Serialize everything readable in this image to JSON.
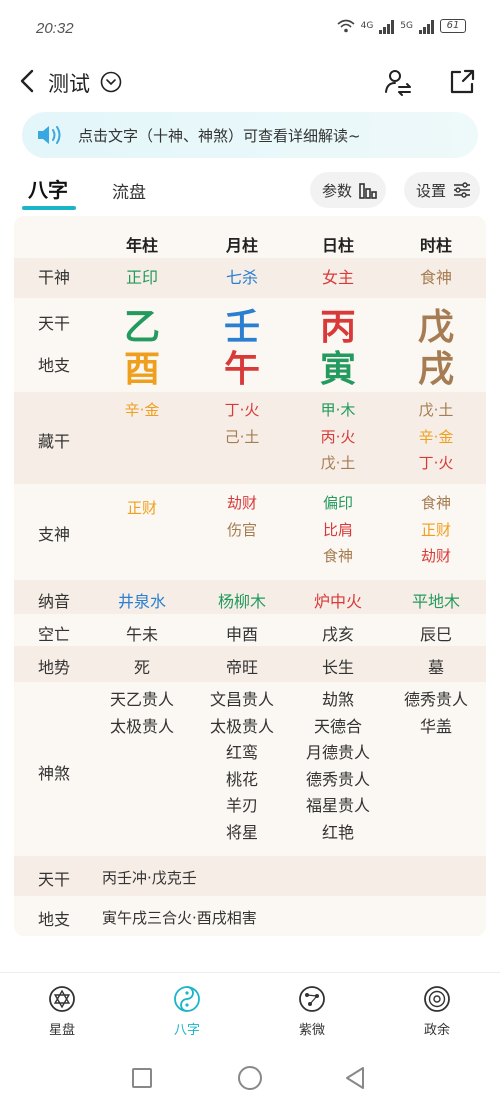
{
  "status": {
    "time": "20:32",
    "net1": "4G",
    "net2": "5G",
    "battery": "61"
  },
  "header": {
    "title": "测试"
  },
  "tip": {
    "text": "点击文字（十神、神煞）可查看详细解读~"
  },
  "tabs": {
    "bazi": "八字",
    "liupan": "流盘",
    "params": "参数",
    "settings": "设置"
  },
  "colors": {
    "accent": "#1bb5c8",
    "wood": "#239a5e",
    "fire": "#d83a3a",
    "earth": "#a67c52",
    "metal": "#ef9f1e",
    "water": "#2a7fd0"
  },
  "table": {
    "columns": [
      "年柱",
      "月柱",
      "日柱",
      "时柱"
    ],
    "labels": {
      "shishen": "干神",
      "tiangan": "天干",
      "dizhi": "地支",
      "canggan": "藏干",
      "zhishen": "支神",
      "nayin": "纳音",
      "kongwang": "空亡",
      "dishi": "地势",
      "shensha": "神煞"
    },
    "shishen": [
      "正印",
      "七杀",
      "女主",
      "食神"
    ],
    "tiangan": [
      "乙",
      "壬",
      "丙",
      "戊"
    ],
    "dizhi": [
      "酉",
      "午",
      "寅",
      "戌"
    ],
    "canggan": [
      [
        "辛·金"
      ],
      [
        "丁·火",
        "己·土"
      ],
      [
        "甲·木",
        "丙·火",
        "戊·土"
      ],
      [
        "戊·土",
        "辛·金",
        "丁·火"
      ]
    ],
    "zhishen": [
      [
        "正财"
      ],
      [
        "劫财",
        "伤官"
      ],
      [
        "偏印",
        "比肩",
        "食神"
      ],
      [
        "食神",
        "正财",
        "劫财"
      ]
    ],
    "nayin": [
      "井泉水",
      "杨柳木",
      "炉中火",
      "平地木"
    ],
    "kongwang": [
      "午未",
      "申酉",
      "戌亥",
      "辰巳"
    ],
    "dishi": [
      "死",
      "帝旺",
      "长生",
      "墓"
    ],
    "shensha": [
      [
        "天乙贵人",
        "太极贵人"
      ],
      [
        "文昌贵人",
        "太极贵人",
        "红鸾",
        "桃花",
        "羊刃",
        "将星"
      ],
      [
        "劫煞",
        "天德合",
        "月德贵人",
        "德秀贵人",
        "福星贵人",
        "红艳"
      ],
      [
        "德秀贵人",
        "华盖"
      ]
    ]
  },
  "interactions": {
    "tiangan_label": "天干",
    "tiangan_text": "丙壬冲·戊克壬",
    "dizhi_label": "地支",
    "dizhi_text": "寅午戌三合火·酉戌相害"
  },
  "nav": [
    {
      "label": "星盘",
      "icon": "star-chart-icon"
    },
    {
      "label": "八字",
      "icon": "yin-yang-icon"
    },
    {
      "label": "紫微",
      "icon": "ziwei-icon"
    },
    {
      "label": "政余",
      "icon": "zhengyu-icon"
    }
  ]
}
